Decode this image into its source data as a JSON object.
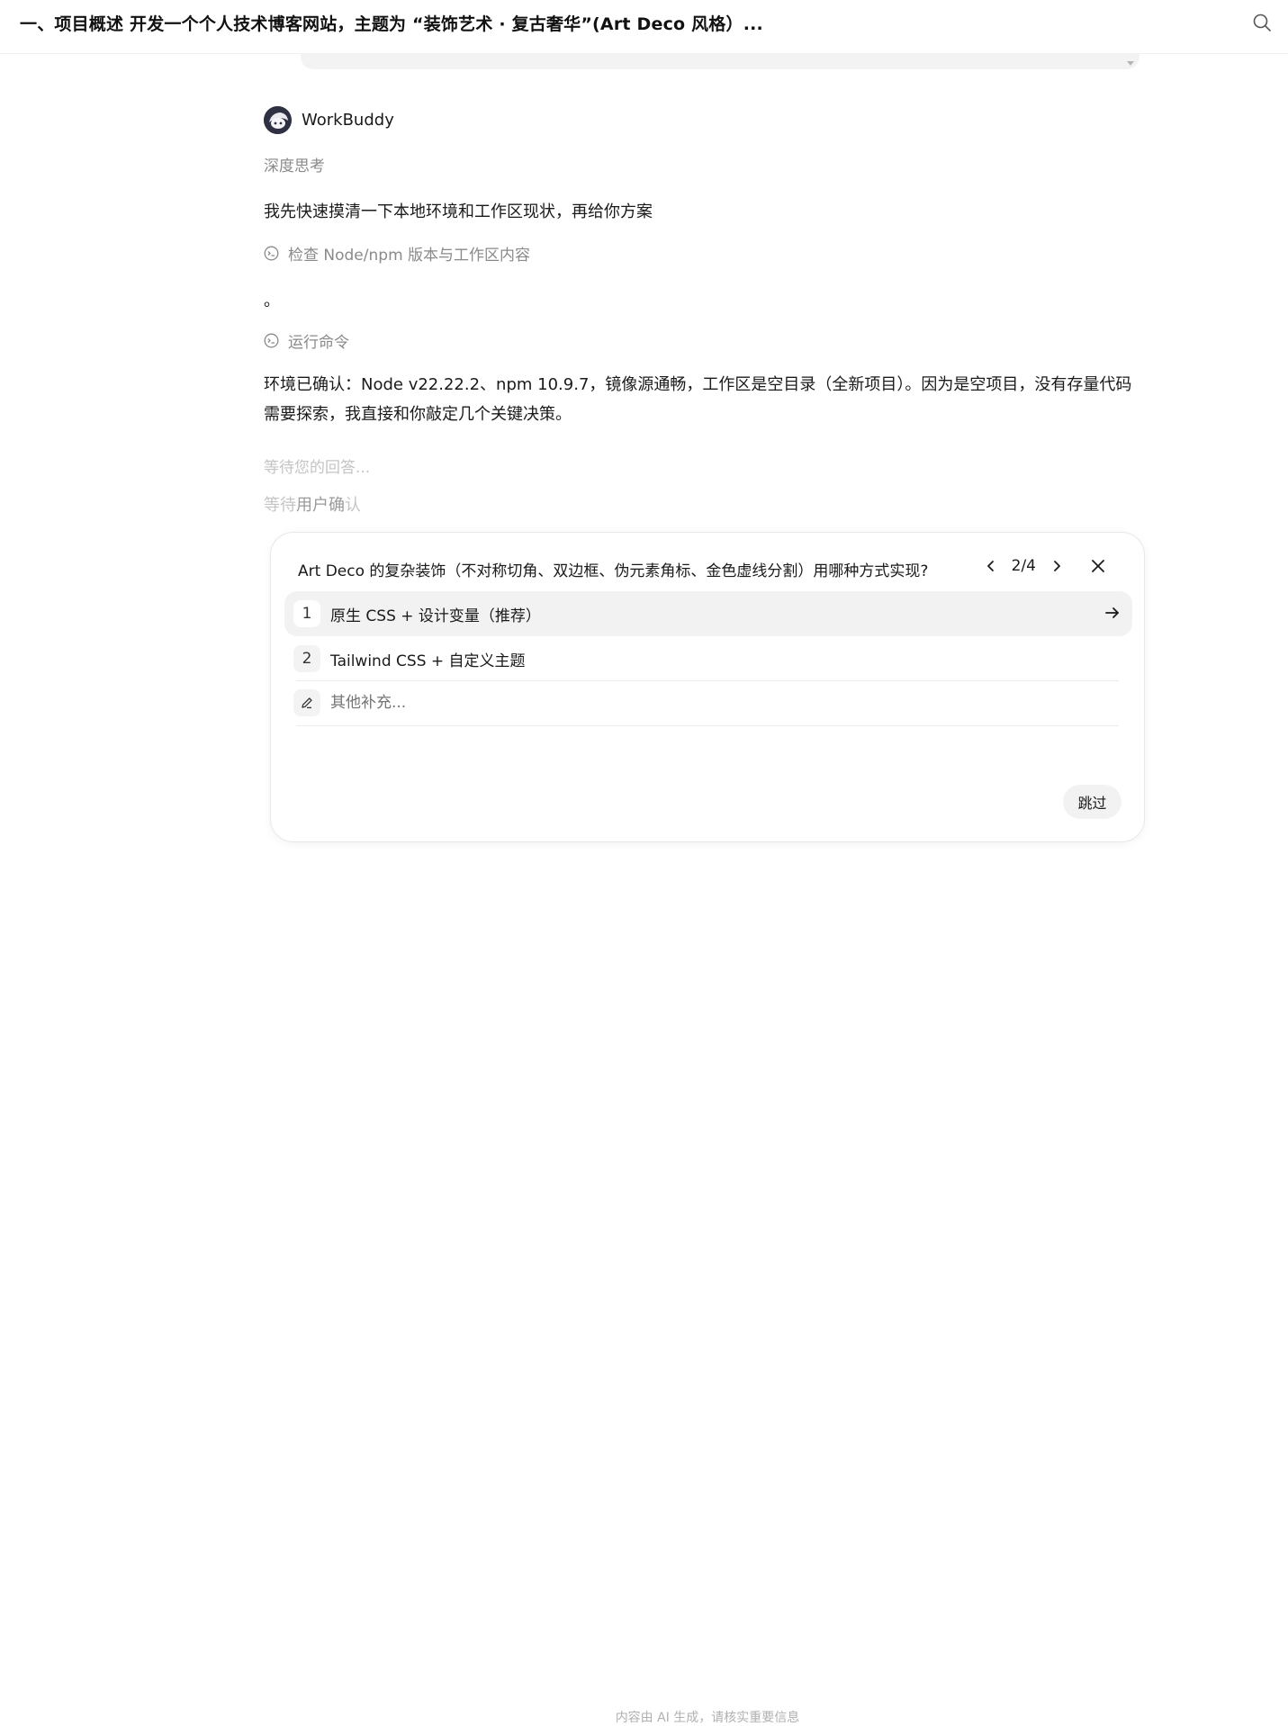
{
  "header": {
    "title": "一、项目概述 开发一个个人技术博客网站，主题为 “装饰艺术 · 复古奢华”(Art Deco 风格）...",
    "search_icon": "search-icon"
  },
  "agent": {
    "name": "WorkBuddy",
    "avatar_icon": "workbuddy-avatar-icon"
  },
  "conversation": {
    "deep_think": "深度思考",
    "intro": "我先快速摸清一下本地环境和工作区现状，再给你方案",
    "tool1": "检查 Node/npm 版本与工作区内容",
    "dot": "。",
    "tool2": "运行命令",
    "env_text": "环境已确认：Node v22.22.2、npm 10.9.7，镜像源通畅，工作区是空目录（全新项目）。因为是空项目，没有存量代码需要探索，我直接和你敲定几个关键决策。",
    "waiting_answer": "等待您的回答...",
    "waiting_confirm_a": "等待",
    "waiting_confirm_b": "用户",
    "waiting_confirm_c": "确",
    "waiting_confirm_d": "认"
  },
  "question": {
    "title": "Art Deco 的复杂装饰（不对称切角、双边框、伪元素角标、金色虚线分割）用哪种方式实现?",
    "page": "2/4",
    "options": [
      {
        "num": "1",
        "label": "原生 CSS + 设计变量（推荐）"
      },
      {
        "num": "2",
        "label": "Tailwind CSS + 自定义主题"
      }
    ],
    "other_placeholder": "其他补充...",
    "skip_label": "跳过"
  },
  "footer": {
    "note": "内容由 AI 生成，请核实重要信息"
  },
  "colors": {
    "muted": "#8a8a8a",
    "faint": "#c4c4c4",
    "card_bg": "#f2f2f2",
    "avatar_bg": "#2e3142"
  }
}
